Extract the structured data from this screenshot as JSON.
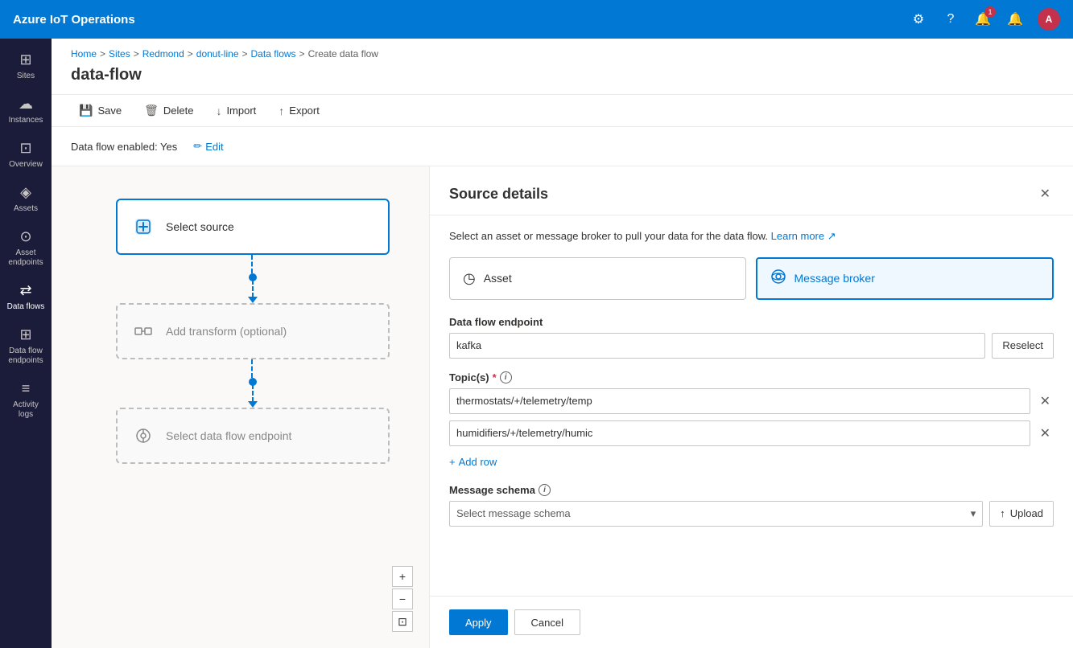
{
  "app": {
    "title": "Azure IoT Operations"
  },
  "top_nav": {
    "title": "Azure IoT Operations",
    "icons": {
      "settings": "⚙",
      "help": "?",
      "notifications": "🔔",
      "alerts": "🔔"
    },
    "notification_badge": "1",
    "avatar_text": "A"
  },
  "sidebar": {
    "items": [
      {
        "id": "sites",
        "label": "Sites",
        "icon": "⊞"
      },
      {
        "id": "instances",
        "label": "Instances",
        "icon": "☁"
      },
      {
        "id": "overview",
        "label": "Overview",
        "icon": "⊡"
      },
      {
        "id": "assets",
        "label": "Assets",
        "icon": "◈"
      },
      {
        "id": "asset-endpoints",
        "label": "Asset endpoints",
        "icon": "⊙"
      },
      {
        "id": "data-flows",
        "label": "Data flows",
        "icon": "⇄",
        "active": true
      },
      {
        "id": "data-flow-endpoints",
        "label": "Data flow endpoints",
        "icon": "⊞"
      },
      {
        "id": "activity-logs",
        "label": "Activity logs",
        "icon": "≡"
      }
    ]
  },
  "breadcrumb": {
    "items": [
      "Home",
      "Sites",
      "Redmond",
      "donut-line",
      "Data flows",
      "Create data flow"
    ]
  },
  "page_title": "data-flow",
  "toolbar": {
    "save_label": "Save",
    "delete_label": "Delete",
    "import_label": "Import",
    "export_label": "Export"
  },
  "flow_status": {
    "label": "Data flow enabled: Yes",
    "edit_label": "Edit"
  },
  "flow_canvas": {
    "nodes": [
      {
        "id": "source",
        "label": "Select source",
        "type": "solid"
      },
      {
        "id": "transform",
        "label": "Add transform (optional)",
        "type": "dashed"
      },
      {
        "id": "endpoint",
        "label": "Select data flow endpoint",
        "type": "dashed"
      }
    ],
    "controls": {
      "zoom_in": "+",
      "zoom_out": "−",
      "fit": "⊡"
    }
  },
  "source_panel": {
    "title": "Source details",
    "description": "Select an asset or message broker to pull your data for the data flow.",
    "learn_more_label": "Learn more",
    "external_link_icon": "↗",
    "close_icon": "✕",
    "source_types": [
      {
        "id": "asset",
        "label": "Asset",
        "icon": "◷",
        "active": false
      },
      {
        "id": "message-broker",
        "label": "Message broker",
        "icon": "⊛",
        "active": true
      }
    ],
    "fields": {
      "endpoint": {
        "label": "Data flow endpoint",
        "placeholder": "kafka",
        "reselect_label": "Reselect"
      },
      "topics": {
        "label": "Topic(s)",
        "required": true,
        "has_info": true,
        "values": [
          "thermostats/+/telemetry/temp",
          "humidifiers/+/telemetry/humic"
        ],
        "add_row_label": "+ Add row"
      },
      "message_schema": {
        "label": "Message schema",
        "has_info": true,
        "placeholder": "Select message schema",
        "upload_label": "Upload",
        "upload_icon": "↑"
      }
    },
    "footer": {
      "apply_label": "Apply",
      "cancel_label": "Cancel"
    }
  }
}
